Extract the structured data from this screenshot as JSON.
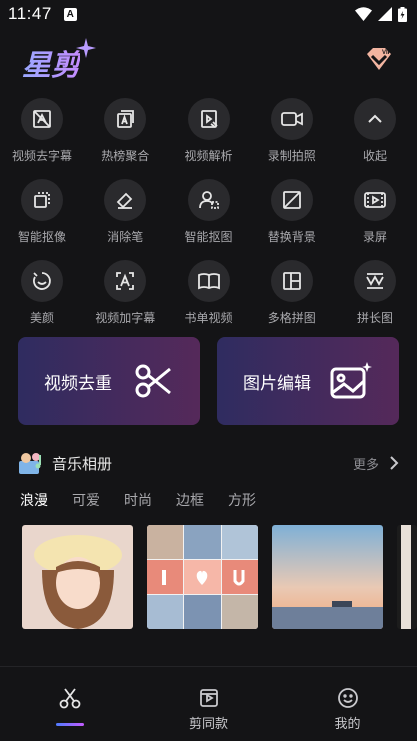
{
  "status": {
    "time": "11:47",
    "badge": "A"
  },
  "app": {
    "logo": "星剪"
  },
  "tools": [
    [
      {
        "name": "tool-video-remove-subtitle",
        "label": "视频去字幕",
        "icon": "video-remove-subtitle-icon"
      },
      {
        "name": "tool-hot-list",
        "label": "热榜聚合",
        "icon": "hot-list-icon"
      },
      {
        "name": "tool-video-parse",
        "label": "视频解析",
        "icon": "video-parse-icon"
      },
      {
        "name": "tool-record-camera",
        "label": "录制拍照",
        "icon": "camera-icon"
      },
      {
        "name": "tool-collapse",
        "label": "收起",
        "icon": "chevron-up-icon"
      }
    ],
    [
      {
        "name": "tool-smart-cutout-portrait",
        "label": "智能抠像",
        "icon": "smart-cutout-icon"
      },
      {
        "name": "tool-eraser",
        "label": "消除笔",
        "icon": "eraser-icon"
      },
      {
        "name": "tool-smart-cutout-image",
        "label": "智能抠图",
        "icon": "person-cutout-icon"
      },
      {
        "name": "tool-replace-background",
        "label": "替换背景",
        "icon": "replace-bg-icon"
      },
      {
        "name": "tool-screen-record",
        "label": "录屏",
        "icon": "screen-record-icon"
      }
    ],
    [
      {
        "name": "tool-beauty",
        "label": "美颜",
        "icon": "beauty-icon"
      },
      {
        "name": "tool-video-add-subtitle",
        "label": "视频加字幕",
        "icon": "add-subtitle-icon"
      },
      {
        "name": "tool-book-video",
        "label": "书单视频",
        "icon": "book-icon"
      },
      {
        "name": "tool-grid-collage",
        "label": "多格拼图",
        "icon": "grid-icon"
      },
      {
        "name": "tool-long-stitch",
        "label": "拼长图",
        "icon": "long-stitch-icon"
      }
    ]
  ],
  "cards": {
    "left": "视频去重",
    "right": "图片编辑"
  },
  "music_album": {
    "title": "音乐相册",
    "more": "更多",
    "tabs": [
      "浪漫",
      "可爱",
      "时尚",
      "边框",
      "方形"
    ],
    "active_tab": 0
  },
  "nav": {
    "edit_label": "",
    "template_label": "剪同款",
    "mine_label": "我的"
  },
  "colors": {
    "accent_start": "#4f7cff",
    "accent_end": "#c45bff",
    "background": "#141416"
  }
}
